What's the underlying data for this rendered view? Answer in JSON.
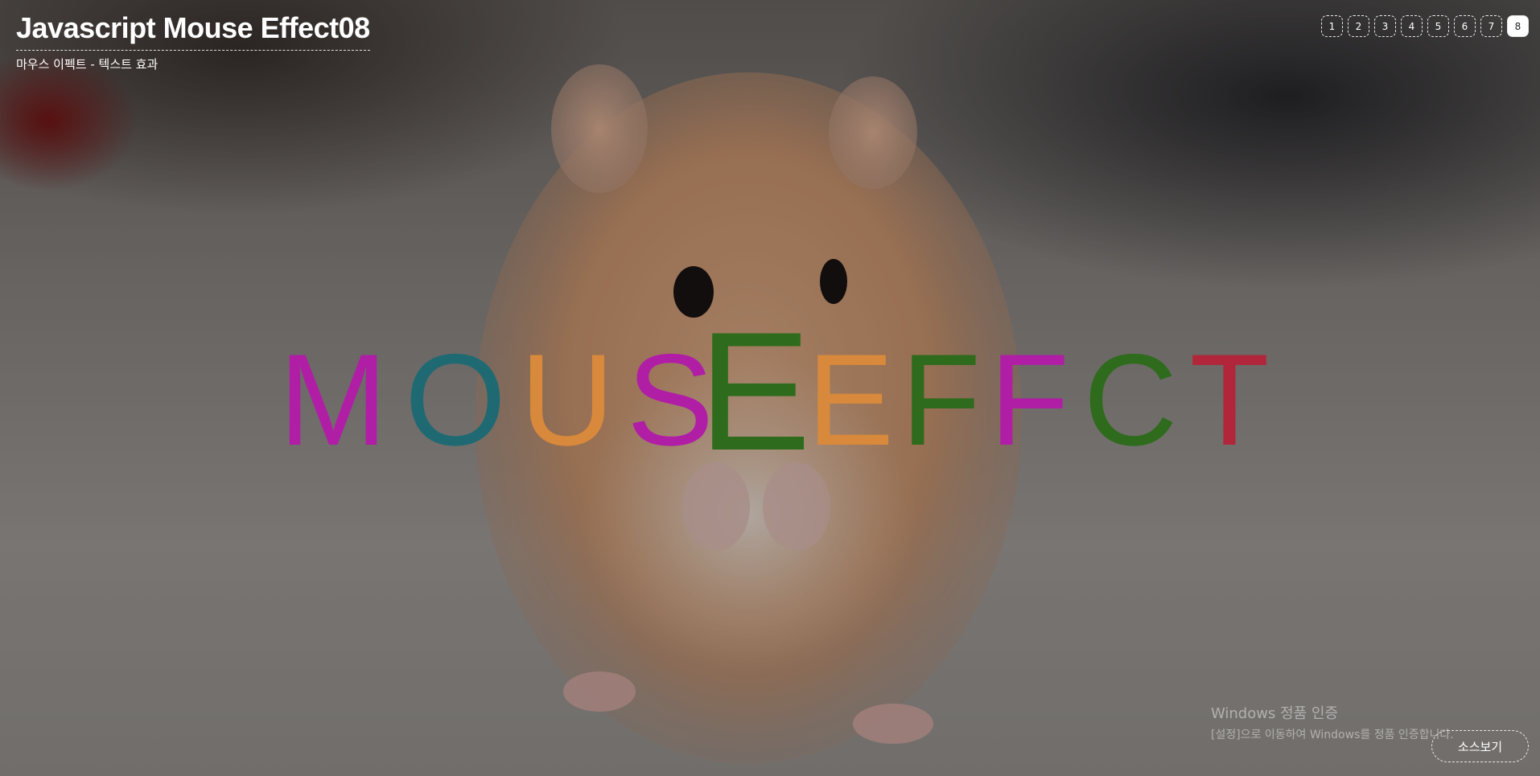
{
  "header": {
    "title": "Javascript Mouse Effect08",
    "subtitle": "마우스 이펙트 - 텍스트 효과"
  },
  "pagination": {
    "pages": [
      "1",
      "2",
      "3",
      "4",
      "5",
      "6",
      "7",
      "8"
    ],
    "active": "8"
  },
  "letters": [
    {
      "char": "M",
      "color": "#b01ea6"
    },
    {
      "char": "O",
      "color": "#1f6a72"
    },
    {
      "char": "U",
      "color": "#d8893c"
    },
    {
      "char": "S",
      "color": "#b01ea6"
    },
    {
      "char": "E",
      "color": "#2e6b1c"
    },
    {
      "char": "E",
      "color": "#d8893c"
    },
    {
      "char": "F",
      "color": "#2e6b1c"
    },
    {
      "char": "F",
      "color": "#b01ea6"
    },
    {
      "char": "C",
      "color": "#2e6b1c"
    },
    {
      "char": "T",
      "color": "#b1263a"
    }
  ],
  "watermark": {
    "title": "Windows 정품 인증",
    "subtitle": "[설정]으로 이동하여 Windows를 정품 인증합니다."
  },
  "source_button": {
    "label": "소스보기"
  }
}
